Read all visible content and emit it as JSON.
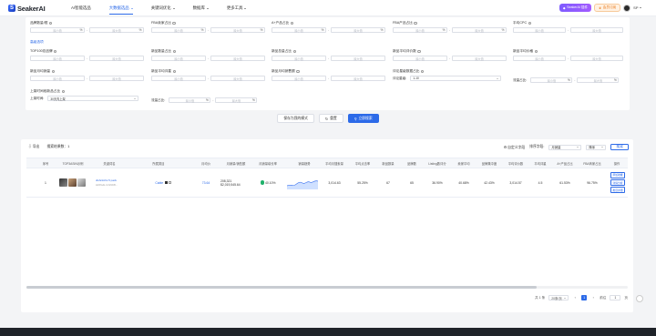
{
  "brand": {
    "name": "SeakerAI",
    "mark": "S"
  },
  "nav": [
    {
      "label": "AI智能选品",
      "active": false,
      "dropdown": false
    },
    {
      "label": "大数据选品",
      "active": true,
      "dropdown": true
    },
    {
      "label": "关键词优化",
      "active": false,
      "dropdown": true
    },
    {
      "label": "数据库",
      "active": false,
      "dropdown": true
    },
    {
      "label": "更多工具",
      "active": false,
      "dropdown": true
    }
  ],
  "top_right": {
    "extension_label": "SeakerAI 插件",
    "order_label": "会员订阅",
    "user": "SP"
  },
  "filters": {
    "row1": [
      {
        "label": "品牌数量/框",
        "min": "最小值",
        "max": "最大值",
        "unit": "%"
      },
      {
        "label": "FBA卖家占比",
        "min": "最小值",
        "max": "最大值",
        "unit": "%"
      },
      {
        "label": "A+产品占比",
        "min": "最小值",
        "max": "最大值",
        "unit": "%"
      },
      {
        "label": "FBA产品占比",
        "min": "最小值",
        "max": "最大值",
        "unit": "%"
      },
      {
        "label": "平均CPC",
        "min": "最小值",
        "max": "最大值",
        "unit": ""
      }
    ],
    "advanced_label": "高级选项",
    "row2": [
      {
        "label": "TOP100总品牌",
        "min": "最小值",
        "max": "最大值"
      },
      {
        "label": "新品数量占比",
        "min": "最小值",
        "max": "最大值"
      },
      {
        "label": "新品总量占比",
        "min": "最小值",
        "max": "最大值"
      },
      {
        "label": "新品平均评价数",
        "min": "最小值",
        "max": "最大值"
      },
      {
        "label": "新品平均价格",
        "min": "最小值",
        "max": "最大值"
      }
    ],
    "row3": [
      {
        "label": "新品月均销量",
        "min": "最小值",
        "max": "最大值"
      },
      {
        "label": "新品平均评星",
        "min": "最小值",
        "max": "最大值"
      },
      {
        "label": "新品月均销售额",
        "min": "最小值",
        "max": "最大值"
      },
      {
        "label": "评论星级数据占比",
        "select_label": "评论星级:",
        "select_value": "1-10"
      },
      {
        "label": "",
        "select_label": "流量占比:",
        "min": "最小值",
        "max": "最大值",
        "unit": "%"
      }
    ],
    "row4": [
      {
        "label": "上架时间段新品占比",
        "select_label": "上架时间:",
        "select_value": "30天内上架"
      },
      {
        "label": "",
        "select_label": "流量占比:",
        "min": "最小值",
        "max": "最大值",
        "unit": "%"
      }
    ]
  },
  "actions": {
    "save_label": "保存为我的模式",
    "reset_label": "重置",
    "search_label": "立即搜索"
  },
  "results_toolbar": {
    "export_label": "导出",
    "count_label": "搜索结果数：1",
    "custom_cols_label": "自定义字段",
    "sort_label": "排序字段:",
    "sort_value": "月销量",
    "order_label": "降序",
    "search_label": "搜索"
  },
  "table": {
    "columns": [
      "序号",
      "TOP3ASIN示例",
      "关键词名",
      "所属类目",
      "月均价",
      "月销量/销售额",
      "月销量增长率",
      "销量趋势",
      "平均月搜索量",
      "平均点击率",
      "新品数量",
      "品牌数",
      "Listing数评分",
      "卖家平均",
      "品牌集中度",
      "平均评价数",
      "平均评星",
      "A+产品占比",
      "FBA商家占比",
      "操作"
    ],
    "rows": [
      {
        "index": "1",
        "keyword": "dishcloths 5 pack",
        "keyword_sub": "AirPods 4 ANC8...",
        "category": "Cable",
        "price": "73.64",
        "sales": "208,321",
        "revenue": "$2,019,545.64",
        "growth": "40.10%",
        "search_volume": "3,014.63",
        "click_rate": "55.25%",
        "new_count": "67",
        "brand_count": "65",
        "listing_score": "36.90%",
        "seller_avg": "40.68%",
        "brand_conc": "42.43%",
        "review_avg": "3,014.57",
        "rating": "4.5",
        "aplus": "61.53%",
        "fba": "96.75%",
        "ops": [
          "添加收藏",
          "详情分析",
          "类目详细"
        ]
      }
    ]
  },
  "pager": {
    "total_label": "共 1 条",
    "page_size": "20条/页",
    "prev": "‹",
    "current": "1",
    "next": "›",
    "goto_label": "前往",
    "goto_value": "1",
    "page_suffix": "页"
  },
  "colors": {
    "accent": "#2c6ae8",
    "success": "#20b26b",
    "footer": "#1f2329"
  }
}
